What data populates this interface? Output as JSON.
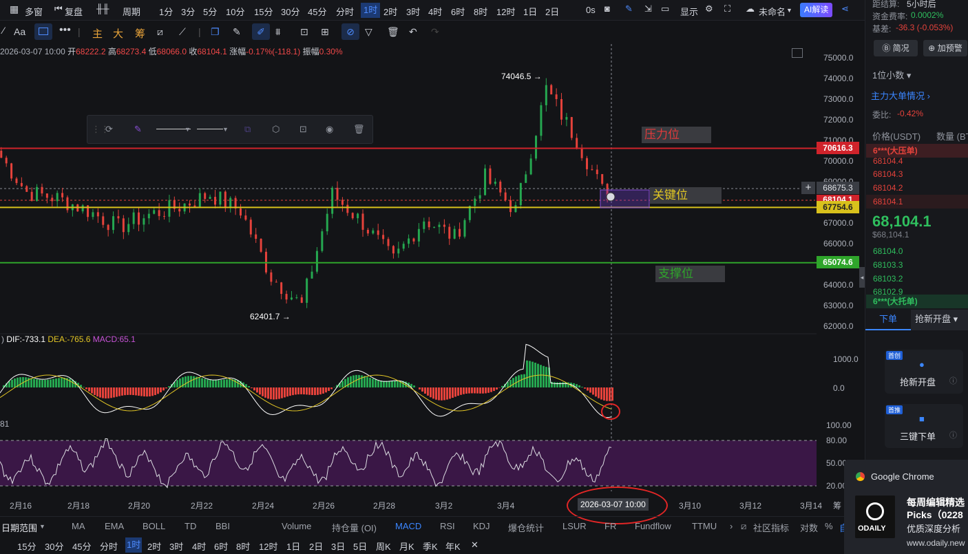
{
  "topbar": {
    "items": [
      "多窗",
      "复盘",
      "周期",
      "1分",
      "3分",
      "5分",
      "10分",
      "15分",
      "30分",
      "45分",
      "分时",
      "1时",
      "2时",
      "3时",
      "4时",
      "6时",
      "8时",
      "12时",
      "1日",
      "2日"
    ],
    "active": "1时",
    "countdown": "0s",
    "display": "显示",
    "layout_name": "未命名",
    "ai_button": "AI解读"
  },
  "toolbar": {
    "text_tool": "Aa",
    "more": "•••",
    "main": "主",
    "big": "大",
    "chips": "筹"
  },
  "ohlc": {
    "time": "2026-03-07 10:00",
    "open_label": "开",
    "open": "68222.2",
    "high_label": "高",
    "high": "68273.4",
    "low_label": "低",
    "low": "68066.0",
    "close_label": "收",
    "close": "68104.1",
    "change_label": "涨幅",
    "change": "-0.17%(-118.1)",
    "amp_label": "振幅",
    "amp": "0.30%"
  },
  "price_axis": [
    "75000.0",
    "74000.0",
    "73000.0",
    "72000.0",
    "71000.0",
    "70000.0",
    "69000.0",
    "68000.0",
    "67000.0",
    "66000.0",
    "65000.0",
    "64000.0",
    "63000.0",
    "62000.0"
  ],
  "macd_axis": [
    "1000.0",
    "0.0"
  ],
  "rsi_axis": [
    "100.00",
    "80.00",
    "50.00",
    "20.00"
  ],
  "price_tags": {
    "pressure": "70616.3",
    "crosshair": "68675.3",
    "last": "68104.1",
    "key": "67754.6",
    "support": "65074.6"
  },
  "annotations": {
    "high": "74046.5",
    "low": "62401.7",
    "pressure": "压力位",
    "key": "关键位",
    "support": "支撑位"
  },
  "macd": {
    "dif_label": "DIF:",
    "dif": "-733.1",
    "dea_label": "DEA:",
    "dea": "-765.6",
    "macd_label": "MACD:",
    "macd": "65.1",
    "side_value": "81"
  },
  "x_axis": [
    "2月16",
    "2月18",
    "2月20",
    "2月22",
    "2月24",
    "2月26",
    "2月28",
    "3月2",
    "3月4",
    "3月10",
    "3月12",
    "3月14"
  ],
  "crosshair_time": "2026-03-07 10:00",
  "indicators": [
    "日期范围",
    "MA",
    "EMA",
    "BOLL",
    "TD",
    "BBI",
    "Volume",
    "持仓量 (OI)",
    "MACD",
    "RSI",
    "KDJ",
    "爆仓统计",
    "LSUR",
    "FR",
    "Fundflow",
    "TTMU",
    "社区指标",
    "对数",
    "%",
    "自"
  ],
  "active_indicator": "MACD",
  "timeframes": [
    "15分",
    "30分",
    "45分",
    "分时",
    "1时",
    "2时",
    "3时",
    "4时",
    "6时",
    "8时",
    "12时",
    "1日",
    "2日",
    "3日",
    "5日",
    "周K",
    "月K",
    "季K",
    "年K"
  ],
  "active_timeframe": "1时",
  "right_panel": {
    "settle_label": "距结算:",
    "settle_value": "5小时后",
    "funding_label": "资金费率:",
    "funding_value": "0.0002%",
    "basis_label": "基差:",
    "basis_value": "-36.3 (-0.053%)",
    "brief_button": "简况",
    "alert_button": "加预警",
    "decimals": "1位小数",
    "big_orders_link": "主力大单情况",
    "ratio_label": "委比:",
    "ratio_value": "-0.42%",
    "price_header": "价格(USDT)",
    "qty_header": "数量 (BT",
    "ask_big": "6***(大压单)",
    "asks": [
      "68104.4",
      "68104.3",
      "68104.2",
      "68104.1"
    ],
    "last_price": "68,104.1",
    "last_price_sub": "$68,104.1",
    "bids": [
      "68104.0",
      "68103.3",
      "68103.2",
      "68102.9"
    ],
    "bid_big": "6***(大托单)",
    "tab_order": "下单",
    "tab_grab": "抢新开盘",
    "card1_badge": "首创",
    "card1_label": "抢新开盘",
    "card2_badge": "首推",
    "card2_label": "三键下单"
  },
  "notification": {
    "app": "Google Chrome",
    "title_line1": "每周编辑精选",
    "title_line2": "Picks（0228",
    "body": "优质深度分析",
    "url": "www.odaily.new",
    "logo_text": "ODAILY"
  },
  "colors": {
    "pressure": "#d0232b",
    "key": "#d8c11c",
    "support": "#2fa52b",
    "up": "#25a750",
    "down": "#e5423b",
    "rsi_fill": "#3a1746"
  },
  "chart_data": {
    "type": "candlestick",
    "timeframe": "1h",
    "ylim": [
      62000,
      75000
    ],
    "levels": [
      {
        "name": "压力位",
        "value": 70616.3
      },
      {
        "name": "关键位",
        "value": 67754.6
      },
      {
        "name": "支撑位",
        "value": 65074.6
      }
    ],
    "marked_high": 74046.5,
    "marked_low": 62401.7,
    "close_path": [
      [
        "2月15",
        70500
      ],
      [
        "2月16",
        68500
      ],
      [
        "2月17",
        68200
      ],
      [
        "2月18",
        67600
      ],
      [
        "2月19",
        66800
      ],
      [
        "2月20",
        67400
      ],
      [
        "2月21",
        67800
      ],
      [
        "2月22",
        68400
      ],
      [
        "2月23",
        67600
      ],
      [
        "2月24",
        64400
      ],
      [
        "2月25",
        63000
      ],
      [
        "2月26",
        68400
      ],
      [
        "2月27",
        67000
      ],
      [
        "2月28",
        65200
      ],
      [
        "3月1",
        67200
      ],
      [
        "3月2",
        66300
      ],
      [
        "3月3",
        69200
      ],
      [
        "3月4",
        67600
      ],
      [
        "3月5",
        73500
      ],
      [
        "3月6",
        71000
      ],
      [
        "3月7",
        68104.1
      ]
    ]
  }
}
